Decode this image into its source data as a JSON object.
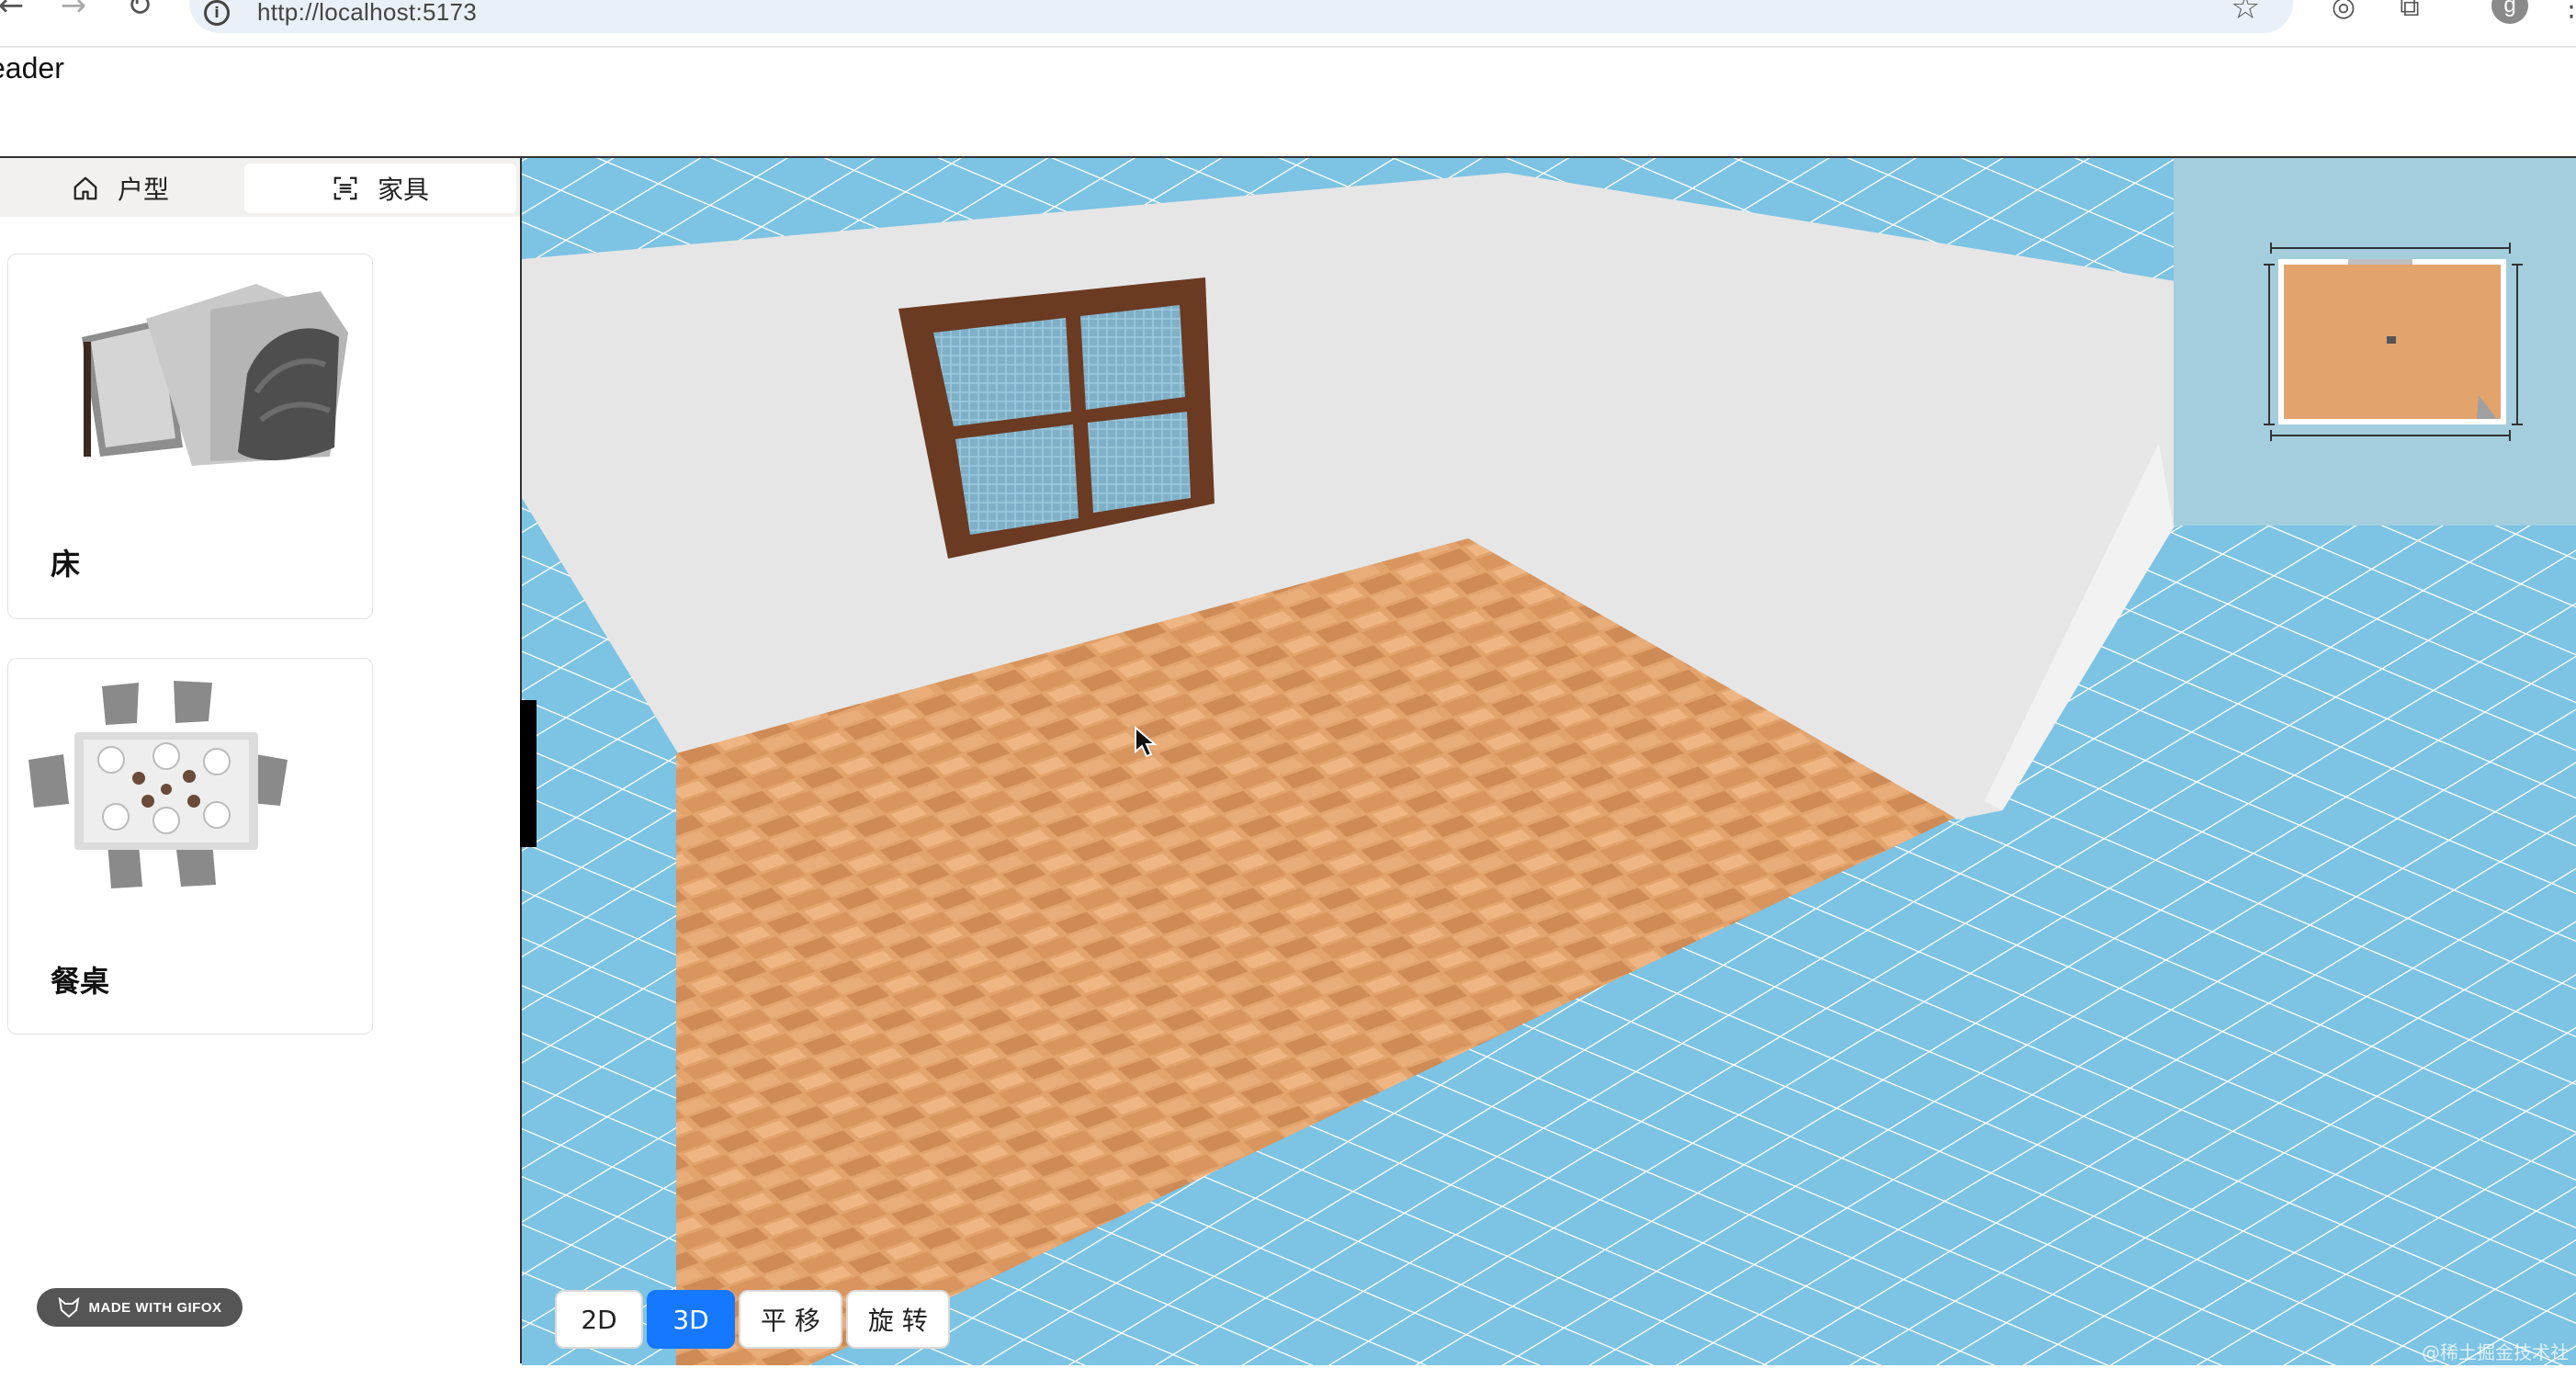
{
  "browser": {
    "url": "http://localhost:5173",
    "avatar_letter": "g"
  },
  "app": {
    "header_text": "eader"
  },
  "sidebar": {
    "tabs": [
      {
        "label": "户型",
        "icon": "home-icon",
        "active": false
      },
      {
        "label": "家具",
        "icon": "scan-icon",
        "active": true
      }
    ],
    "items": [
      {
        "label": "床",
        "icon": "bed-model-thumbnail"
      },
      {
        "label": "餐桌",
        "icon": "dining-table-model-thumbnail"
      }
    ],
    "badge": "MADE WITH GIFOX"
  },
  "toolbar": {
    "buttons": [
      {
        "label": "2D",
        "active": false
      },
      {
        "label": "3D",
        "active": true
      },
      {
        "label": "平 移",
        "active": false
      },
      {
        "label": "旋 转",
        "active": false
      }
    ]
  },
  "watermark": "@稀土掘金技术社区",
  "colors": {
    "accent": "#1677ff",
    "floor": "#e3a36c",
    "grid_background": "#7cc3e4",
    "wall": "#e6e6e6",
    "minimap_background": "#a4cedd",
    "window_frame": "#6b3a22",
    "glass": "#7fb0c7"
  }
}
